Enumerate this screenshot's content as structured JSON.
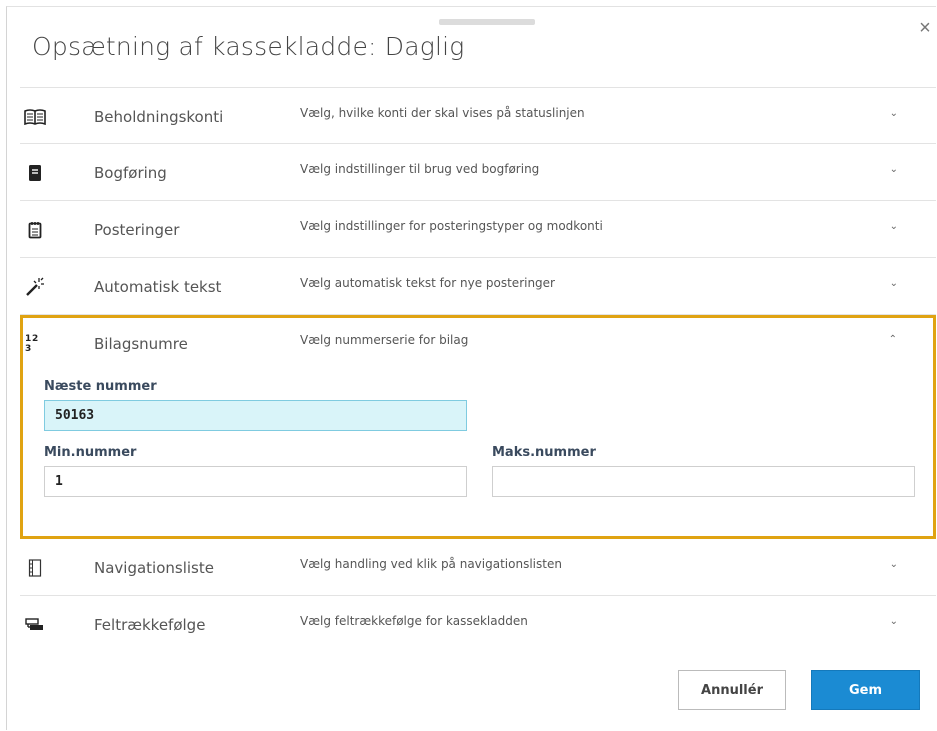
{
  "dialog": {
    "title": "Opsætning af kassekladde: Daglig",
    "close_symbol": "×"
  },
  "sections": [
    {
      "icon": "book-open-icon",
      "name": "Beholdningskonti",
      "description": "Vælg, hvilke konti der skal vises på statuslinjen",
      "chevron": "⌄"
    },
    {
      "icon": "ledger-book-icon",
      "name": "Bogføring",
      "description": "Vælg indstillinger til brug ved bogføring",
      "chevron": "⌄"
    },
    {
      "icon": "notepad-icon",
      "name": "Posteringer",
      "description": "Vælg indstillinger for posteringstyper og modkonti",
      "chevron": "⌄"
    },
    {
      "icon": "magic-wand-icon",
      "name": "Automatisk tekst",
      "description": "Vælg automatisk tekst for nye posteringer",
      "chevron": "⌄"
    }
  ],
  "expanded": {
    "icon_text": "1 2 3",
    "name": "Bilagsnumre",
    "description": "Vælg nummerserie for bilag",
    "chevron": "⌃",
    "next_label": "Næste nummer",
    "next_value": "50163",
    "min_label": "Min.nummer",
    "min_value": "1",
    "max_label": "Maks.nummer",
    "max_value": ""
  },
  "sections_after": [
    {
      "icon": "navigation-list-icon",
      "name": "Navigationsliste",
      "description": "Vælg handling ved klik på navigationslisten",
      "chevron": "⌄"
    },
    {
      "icon": "tab-order-icon",
      "name": "Feltrækkefølge",
      "description": "Vælg feltrækkefølge for kassekladden",
      "chevron": "⌄"
    }
  ],
  "buttons": {
    "cancel": "Annullér",
    "save": "Gem"
  },
  "colors": {
    "accent_border": "#e0a312",
    "primary": "#1b8bd3",
    "focus_bg": "#d9f4f9"
  }
}
